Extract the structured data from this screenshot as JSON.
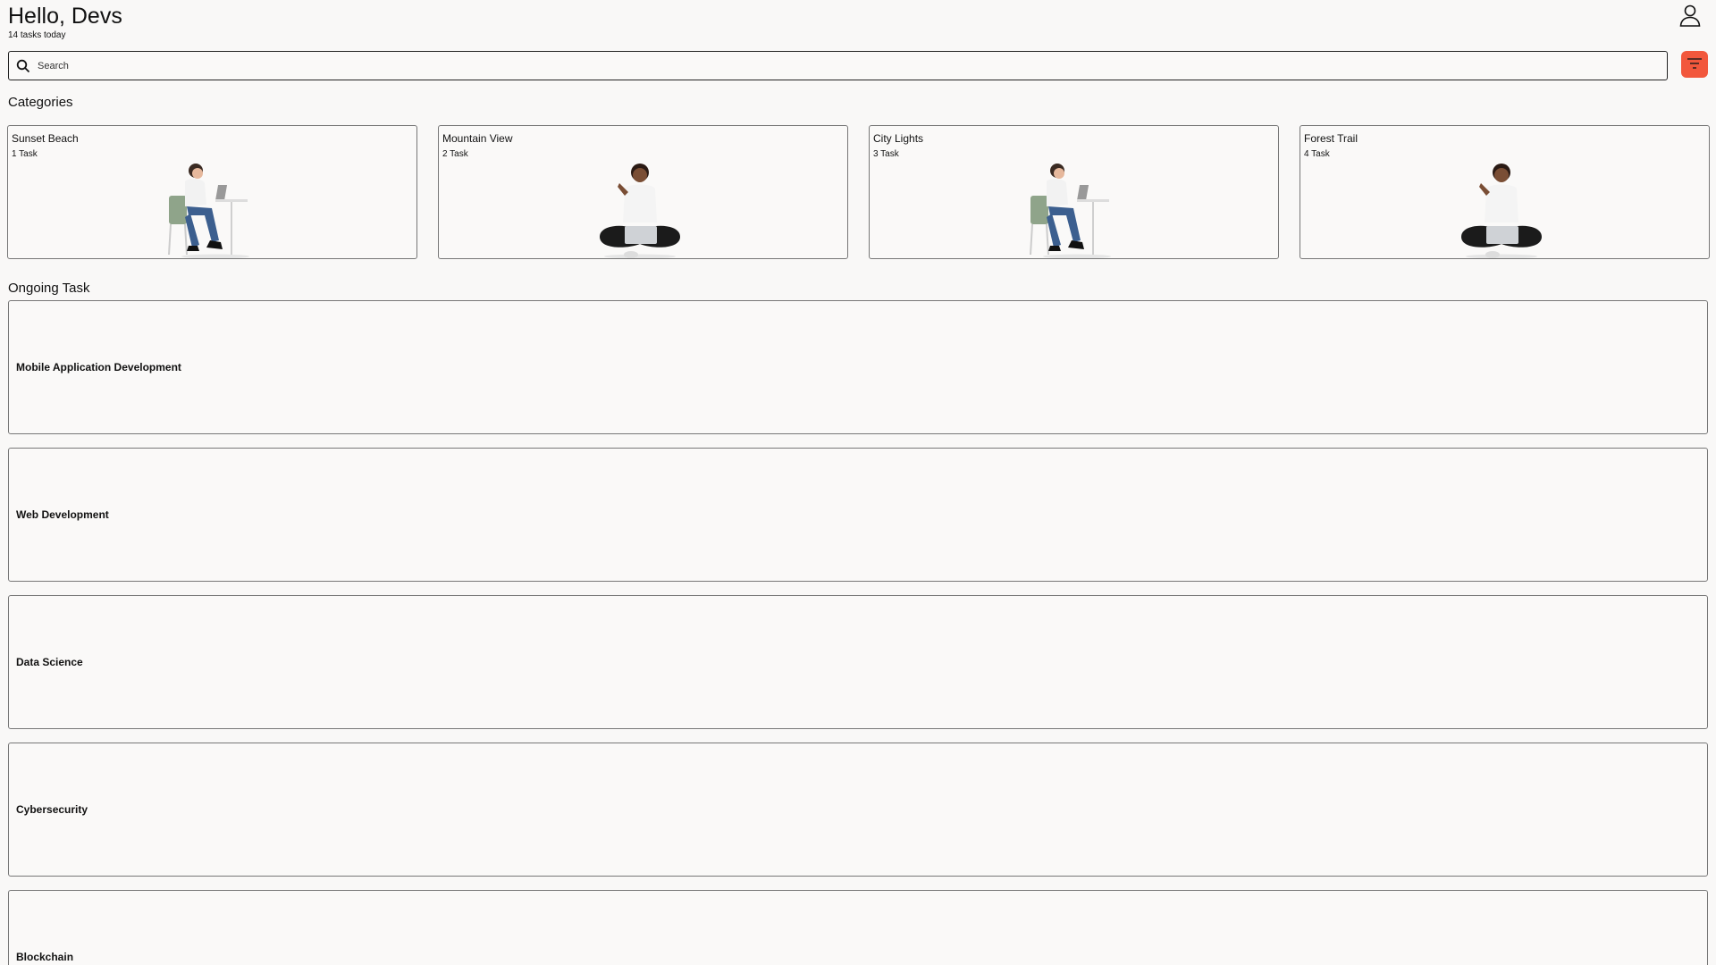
{
  "header": {
    "greeting": "Hello, Devs",
    "subtitle": "14 tasks today",
    "profile_icon": "user-icon"
  },
  "search": {
    "placeholder": "Search",
    "value": "",
    "icon": "search-icon"
  },
  "filter": {
    "icon": "filter-icon",
    "color": "#f2573c"
  },
  "sections": {
    "categories": "Categories",
    "ongoing": "Ongoing Task"
  },
  "categories": [
    {
      "title": "Sunset Beach",
      "count": "1 Task",
      "illustration": "person-at-desk-with-laptop"
    },
    {
      "title": "Mountain View",
      "count": "2 Task",
      "illustration": "person-sitting-cross-legged-with-laptop"
    },
    {
      "title": "City Lights",
      "count": "3 Task",
      "illustration": "person-at-desk-with-laptop"
    },
    {
      "title": "Forest Trail",
      "count": "4 Task",
      "illustration": "person-sitting-cross-legged-with-laptop"
    }
  ],
  "tasks": [
    {
      "name": "Mobile Application Development"
    },
    {
      "name": "Web Development"
    },
    {
      "name": "Data Science"
    },
    {
      "name": "Cybersecurity"
    },
    {
      "name": "Blockchain"
    }
  ]
}
